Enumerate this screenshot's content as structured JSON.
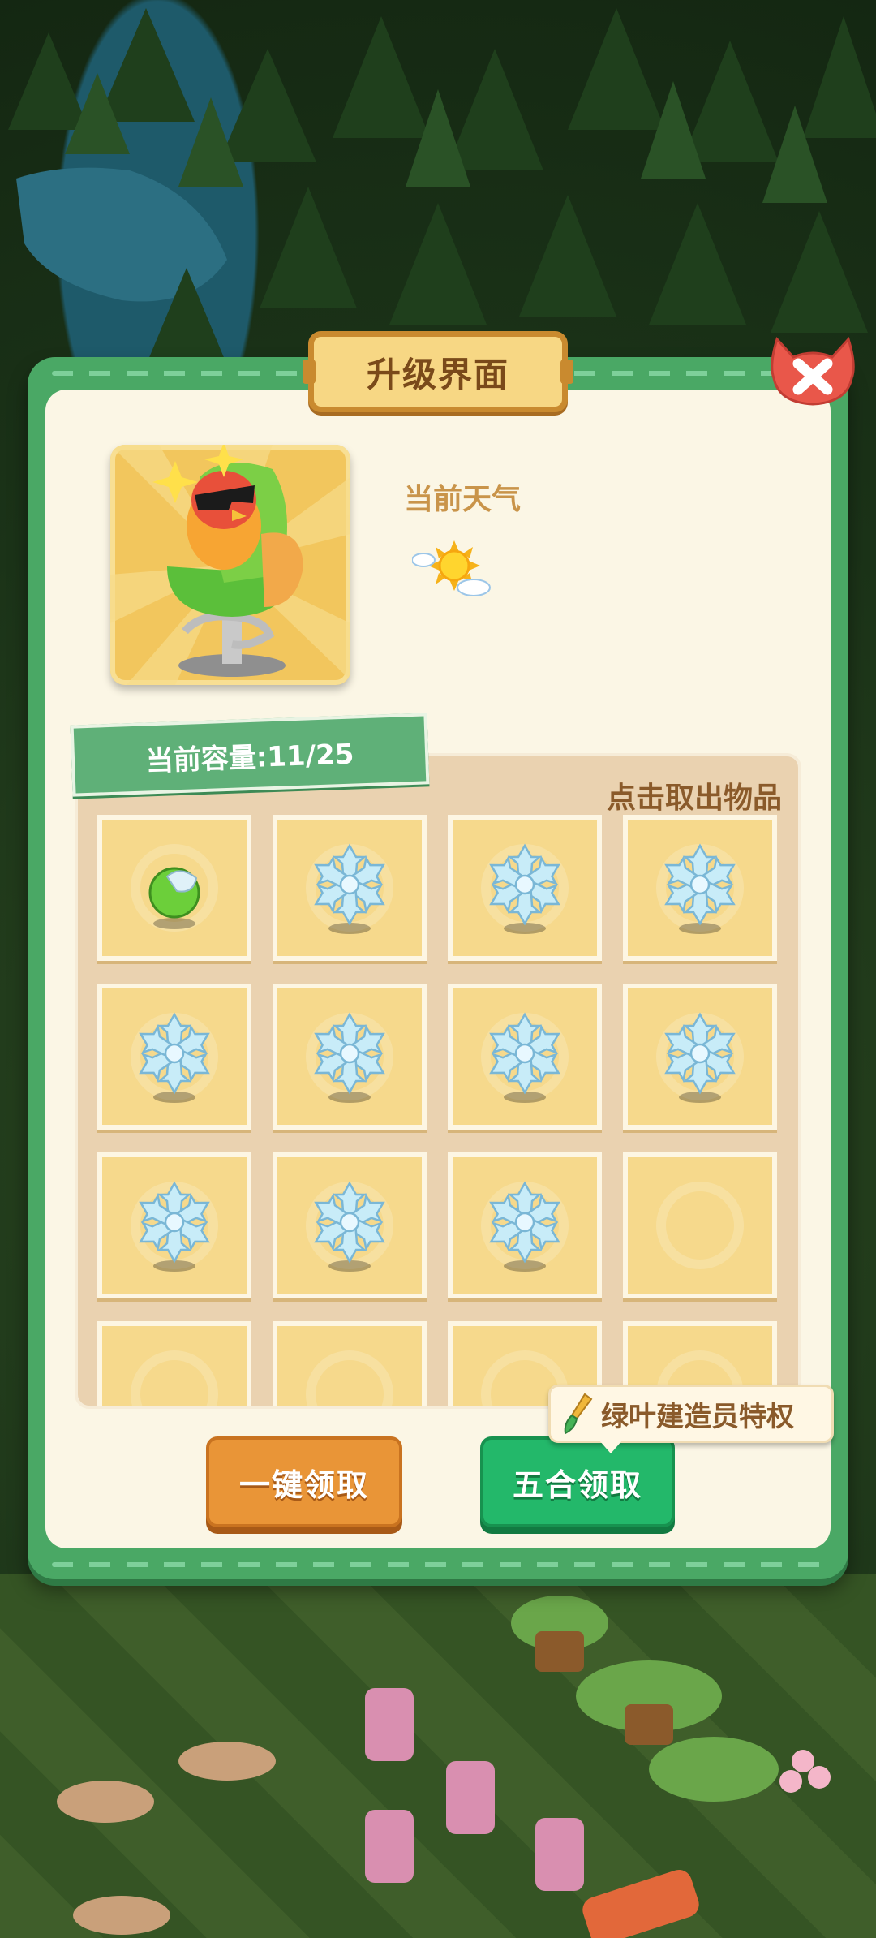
{
  "dialog": {
    "title": "升级界面",
    "close_icon": "close-x-icon"
  },
  "preview": {
    "item_icon": "salon-chair-with-sunglasses-bird-icon"
  },
  "weather": {
    "label": "当前天气",
    "icon": "sunny-cloud-icon"
  },
  "inventory": {
    "capacity_label": "当前容量:11/25",
    "hint": "点击取出物品",
    "slots": [
      {
        "item": "green-ball"
      },
      {
        "item": "snowflake"
      },
      {
        "item": "snowflake"
      },
      {
        "item": "snowflake"
      },
      {
        "item": "snowflake"
      },
      {
        "item": "snowflake"
      },
      {
        "item": "snowflake"
      },
      {
        "item": "snowflake"
      },
      {
        "item": "snowflake"
      },
      {
        "item": "snowflake"
      },
      {
        "item": "snowflake"
      },
      {
        "item": "empty"
      },
      {
        "item": "empty"
      },
      {
        "item": "empty"
      },
      {
        "item": "empty"
      },
      {
        "item": "empty"
      }
    ]
  },
  "buttons": {
    "claim_all": "一键领取",
    "merge_claim": "五合领取"
  },
  "privilege": {
    "label": "绿叶建造员特权",
    "icon": "paintbrush-icon"
  },
  "colors": {
    "frame_green": "#4aa865",
    "panel_cream": "#fbf6e5",
    "title_gold": "#f7d784",
    "button_orange": "#e99537",
    "button_green": "#23b86a",
    "close_red": "#e9574a"
  }
}
